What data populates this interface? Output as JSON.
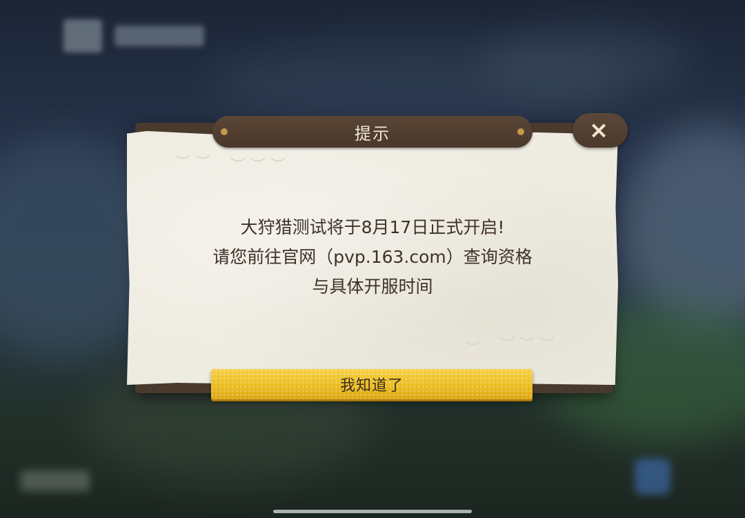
{
  "dialog": {
    "title": "提示",
    "close_icon": "×",
    "message_lines": [
      "大狩猎测试将于8月17日正式开启!",
      "请您前往官网（pvp.163.com）查询资格",
      "与具体开服时间"
    ],
    "confirm_label": "我知道了"
  },
  "colors": {
    "frame": "#4a3a2e",
    "paper": "#eeebe1",
    "confirm": "#ebbd22",
    "text": "#3e3128"
  }
}
